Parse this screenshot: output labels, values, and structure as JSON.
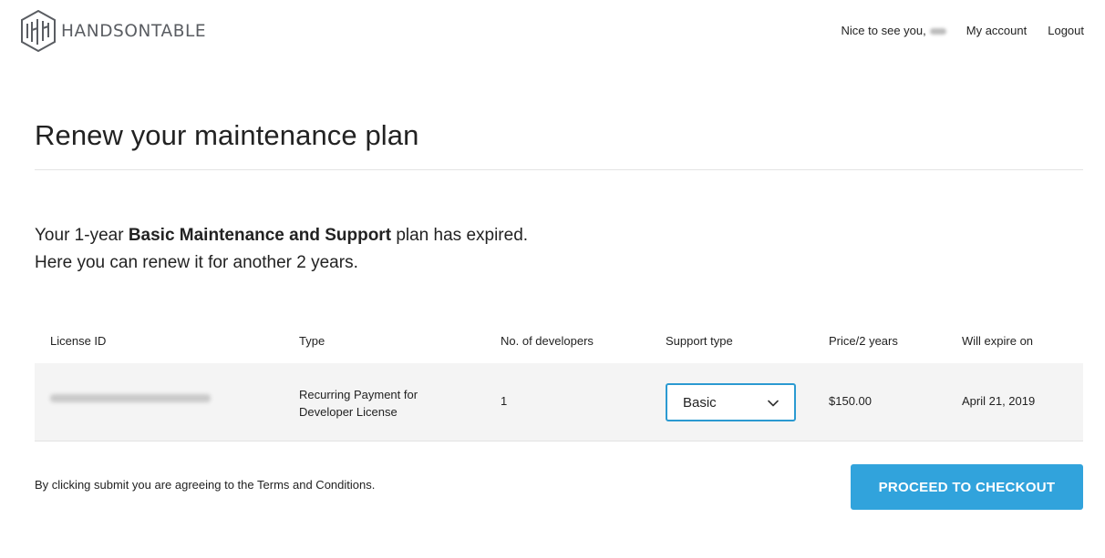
{
  "header": {
    "brand": "HANDSONTABLE",
    "greeting": "Nice to see you,",
    "nav": {
      "account": "My account",
      "logout": "Logout"
    }
  },
  "page": {
    "title": "Renew your maintenance plan"
  },
  "intro": {
    "line1_prefix": "Your 1-year ",
    "line1_bold": "Basic Maintenance and Support",
    "line1_suffix": " plan has expired.",
    "line2": "Here you can renew it for another 2 years."
  },
  "table": {
    "headers": {
      "license": "License ID",
      "type": "Type",
      "developers": "No. of developers",
      "support": "Support type",
      "price": "Price/2 years",
      "expire": "Will expire on"
    },
    "row": {
      "type_line1": "Recurring Payment for",
      "type_line2": "Developer License",
      "developers": "1",
      "support_selected": "Basic",
      "price": "$150.00",
      "expire": "April 21, 2019"
    }
  },
  "footer": {
    "terms": "By clicking submit you are agreeing to the Terms and Conditions.",
    "checkout_label": "PROCEED TO CHECKOUT"
  },
  "colors": {
    "accent": "#31a3dc",
    "select_border": "#2b9ad1",
    "row_background": "#f4f4f4"
  },
  "icons": {
    "logo": "handsontable-logo-icon",
    "select": "chevron-down-icon"
  }
}
